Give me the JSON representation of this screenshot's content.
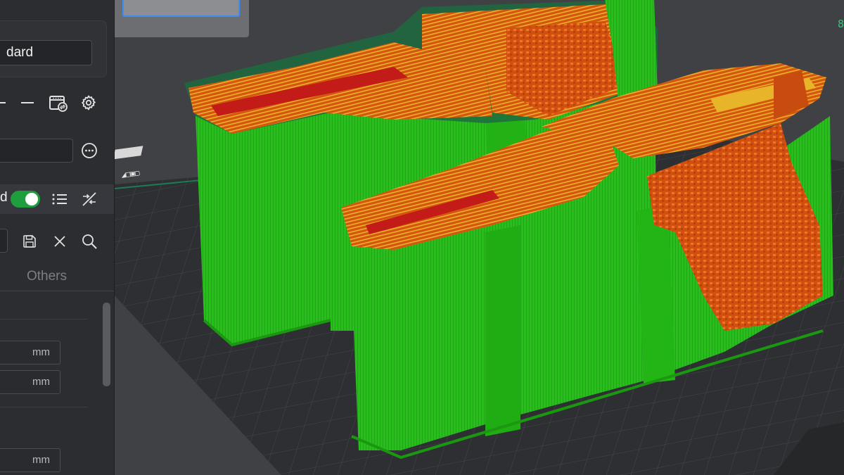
{
  "preset": {
    "value": "dard"
  },
  "mode_row": {
    "label": "d",
    "toggle_on": true
  },
  "tabs": {
    "others": "Others"
  },
  "fields": [
    {
      "unit": "mm"
    },
    {
      "unit": "mm"
    },
    {
      "unit": "mm"
    }
  ],
  "viewport": {
    "edge_text": "8"
  },
  "icons": {
    "minus_a": "minus-icon",
    "minus_b": "minus-icon",
    "plate_settings": "plate-settings-icon",
    "settings": "gear-icon",
    "more": "more-options-icon",
    "list": "list-icon",
    "compare": "compare-icon",
    "save": "save-icon",
    "close": "close-icon",
    "search": "search-icon"
  },
  "colors": {
    "panel_bg": "#2c2d31",
    "toggle_on": "#1f9e3d",
    "support": "#2bc21d",
    "model_orange": "#d4520f",
    "model_yellow": "#e0b22a",
    "model_red": "#c21b18",
    "plate": "#2e2f33"
  }
}
